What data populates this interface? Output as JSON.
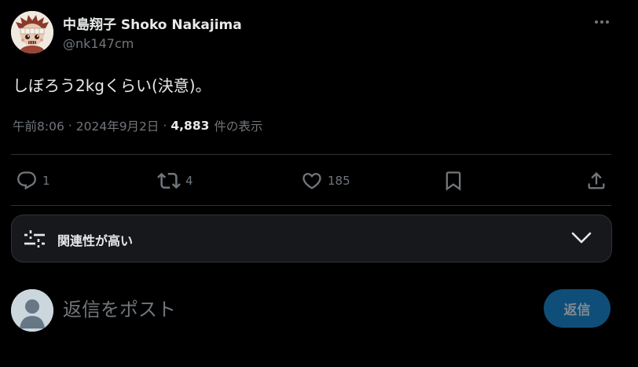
{
  "author": {
    "display_name": "中島翔子 Shoko Nakajima",
    "handle": "@nk147cm"
  },
  "tweet": {
    "text": "しぼろう2kgくらい(決意)。",
    "time": "午前8:06",
    "separator": "·",
    "date": "2024年9月2日",
    "view_count": "4,883",
    "view_label": "件の表示"
  },
  "actions": {
    "reply_count": "1",
    "retweet_count": "4",
    "like_count": "185",
    "reply_icon": "reply-icon",
    "retweet_icon": "retweet-icon",
    "like_icon": "heart-icon",
    "bookmark_icon": "bookmark-icon",
    "share_icon": "share-icon"
  },
  "filter": {
    "label": "関連性が高い",
    "icon": "sliders-icon",
    "chevron": "chevron-down-icon"
  },
  "reply": {
    "placeholder": "返信をポスト",
    "button_label": "返信"
  },
  "colors": {
    "background": "#000000",
    "text_primary": "#e7e9ea",
    "text_secondary": "#71767b",
    "divider": "#2f3336",
    "reply_button_bg": "#0f4e78"
  }
}
